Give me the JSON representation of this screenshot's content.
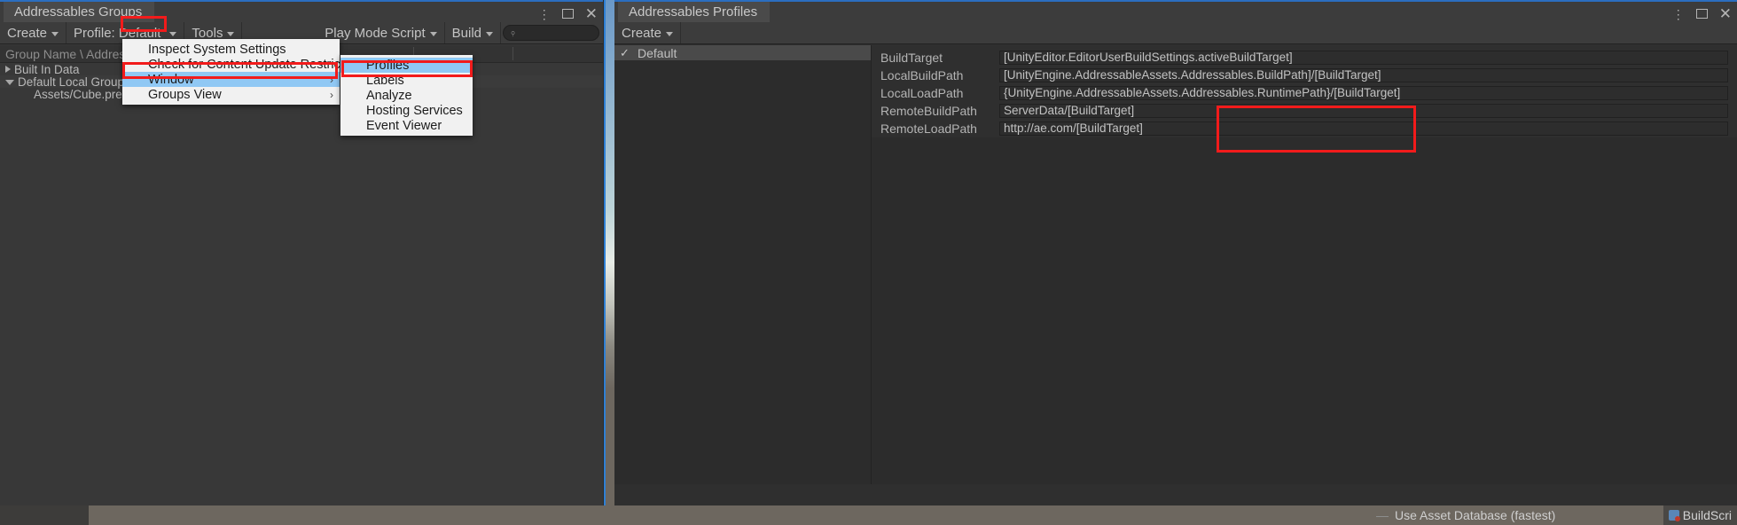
{
  "groups_window": {
    "tab_title": "Addressables Groups",
    "window_controls": {
      "menu": "⋮",
      "maximize": "maximize-box",
      "close": "✕"
    },
    "toolbar": {
      "create_label": "Create",
      "profile_label": "Profile: Default",
      "tools_label": "Tools",
      "play_mode_script_label": "Play Mode Script",
      "build_label": "Build",
      "search_placeholder": ""
    },
    "column_header": "Group Name \\ Addressable Name",
    "tree_rows": [
      {
        "label": "Built In Data",
        "indent": 6,
        "arrow": "collapsed"
      },
      {
        "label": "Default Local Group (Default)",
        "indent": 6,
        "arrow": "expanded"
      },
      {
        "label": "Assets/Cube.prefab",
        "indent": 38,
        "arrow": "none"
      }
    ]
  },
  "tools_menu": {
    "items": [
      {
        "label": "Inspect System Settings",
        "selected": false,
        "submenu": false
      },
      {
        "label": "Check for Content Update Restrictions",
        "selected": false,
        "submenu": false
      },
      {
        "label": "Window",
        "selected": true,
        "submenu": true
      },
      {
        "label": "Groups View",
        "selected": false,
        "submenu": true
      }
    ]
  },
  "window_submenu": {
    "items": [
      {
        "label": "Profiles",
        "selected": true
      },
      {
        "label": "Labels",
        "selected": false
      },
      {
        "label": "Analyze",
        "selected": false
      },
      {
        "label": "Hosting Services",
        "selected": false
      },
      {
        "label": "Event Viewer",
        "selected": false
      }
    ]
  },
  "profiles_window": {
    "tab_title": "Addressables Profiles",
    "window_controls": {
      "menu": "⋮",
      "maximize": "maximize-box",
      "close": "✕"
    },
    "toolbar": {
      "create_label": "Create"
    },
    "profile_list": [
      {
        "name": "Default",
        "active": true,
        "check": "✓"
      }
    ],
    "fields": [
      {
        "name": "BuildTarget",
        "value": "[UnityEditor.EditorUserBuildSettings.activeBuildTarget]"
      },
      {
        "name": "LocalBuildPath",
        "value": "[UnityEngine.AddressableAssets.Addressables.BuildPath]/[BuildTarget]"
      },
      {
        "name": "LocalLoadPath",
        "value": "{UnityEngine.AddressableAssets.Addressables.RuntimePath}/[BuildTarget]"
      },
      {
        "name": "RemoteBuildPath",
        "value": "ServerData/[BuildTarget]"
      },
      {
        "name": "RemoteLoadPath",
        "value": "http://ae.com/[BuildTarget]"
      }
    ]
  },
  "status_bar": {
    "play_mode_text": "Use Asset Database (fastest)",
    "dash_glyph": "—",
    "build_script_text": "BuildScri"
  },
  "colors": {
    "highlight_red": "#f21b1b",
    "menu_selection_blue": "#90c8f4",
    "window_accent_blue": "#2b6ec0",
    "panel_bg": "#383838",
    "toolbar_bg": "#3c3c3c"
  }
}
